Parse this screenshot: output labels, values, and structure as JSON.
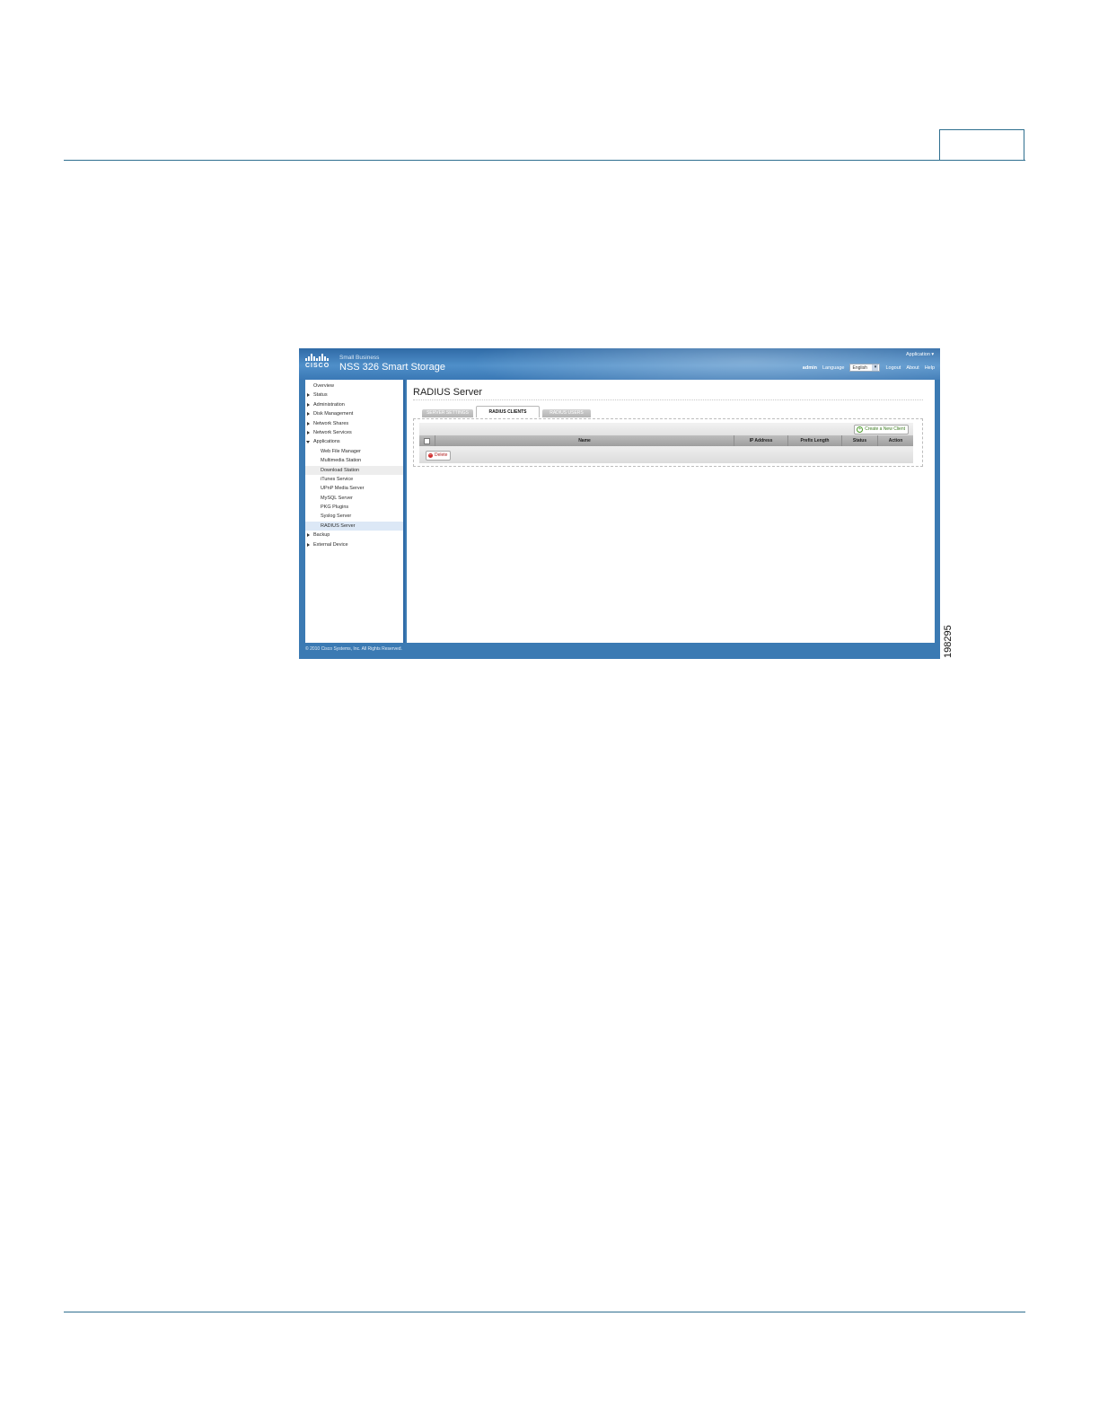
{
  "header": {
    "subtitle": "Small Business",
    "product": "NSS 326 Smart Storage",
    "logo_word": "CISCO",
    "app_menu": "Application ▾",
    "user": "admin",
    "language_label": "Language",
    "language_value": "English",
    "logout": "Logout",
    "about": "About",
    "help": "Help"
  },
  "sidebar": {
    "items": [
      {
        "label": "Overview",
        "level": 0,
        "caret": "none"
      },
      {
        "label": "Status",
        "level": 0,
        "caret": "closed"
      },
      {
        "label": "Administration",
        "level": 0,
        "caret": "closed"
      },
      {
        "label": "Disk Management",
        "level": 0,
        "caret": "closed"
      },
      {
        "label": "Network Shares",
        "level": 0,
        "caret": "closed"
      },
      {
        "label": "Network Services",
        "level": 0,
        "caret": "closed"
      },
      {
        "label": "Applications",
        "level": 0,
        "caret": "open"
      },
      {
        "label": "Web File Manager",
        "level": 1
      },
      {
        "label": "Multimedia Station",
        "level": 1
      },
      {
        "label": "Download Station",
        "level": 1
      },
      {
        "label": "iTunes Service",
        "level": 1
      },
      {
        "label": "UPnP Media Server",
        "level": 1
      },
      {
        "label": "MySQL Server",
        "level": 1
      },
      {
        "label": "PKG Plugins",
        "level": 1
      },
      {
        "label": "Syslog Server",
        "level": 1
      },
      {
        "label": "RADIUS Server",
        "level": 1
      },
      {
        "label": "Backup",
        "level": 0,
        "caret": "closed"
      },
      {
        "label": "External Device",
        "level": 0,
        "caret": "closed"
      }
    ]
  },
  "main": {
    "title": "RADIUS Server",
    "tabs": [
      {
        "label": "SERVER SETTINGS"
      },
      {
        "label": "RADIUS CLIENTS"
      },
      {
        "label": "RADIUS USERS"
      }
    ],
    "create_button": "Create a New Client",
    "columns": [
      "Name",
      "IP Address",
      "Prefix Length",
      "Status",
      "Action"
    ],
    "delete_button": "Delete"
  },
  "footer": {
    "copyright": "© 2010 Cisco Systems, Inc. All Rights Reserved."
  },
  "figure_number": "198295",
  "colors": {
    "banner": "#3b7ab3",
    "accent": "#2f6aa6",
    "rule": "#2f6f8f"
  }
}
